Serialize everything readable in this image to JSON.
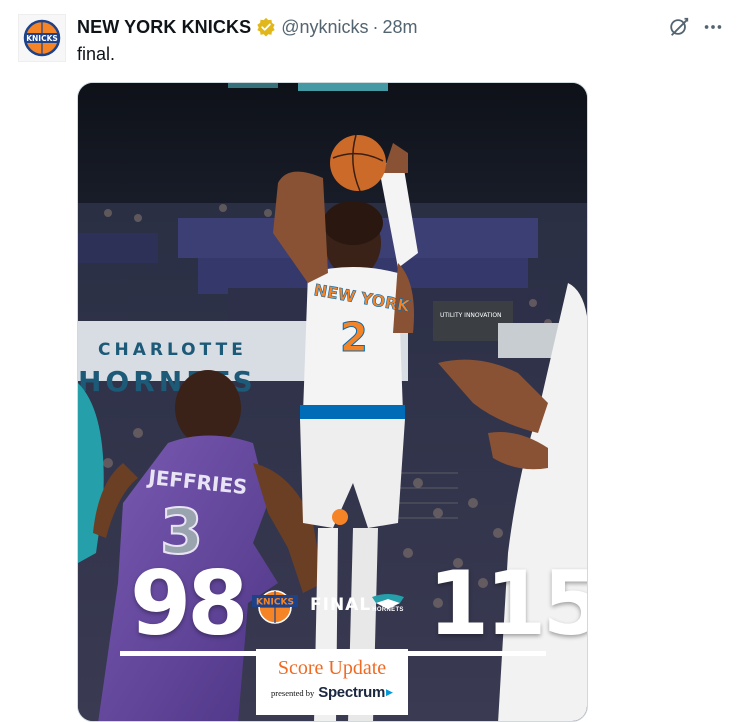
{
  "tweet": {
    "display_name": "NEW YORK KNICKS",
    "handle": "@nyknicks",
    "separator": "·",
    "time": "28m",
    "text": "final."
  },
  "icons": {
    "avatar": "knicks-logo-icon",
    "verified": "verified-badge-icon",
    "grok": "grok-icon",
    "more": "more-icon"
  },
  "media": {
    "arena_sign": "CHARLOTTE",
    "arena_sign_partial": "HORNETS",
    "utility_sign": "UTILITY INNOVATION",
    "player_jersey_city": "NEW YORK",
    "player_jersey_number": "2",
    "defender_name": "JEFFRIES",
    "defender_number": "3",
    "knicks_logo_text": "KNICKS",
    "hornets_logo_text": "HORNETS",
    "score_left": "98",
    "score_right": "115",
    "status": "FINAL",
    "banner_title": "Score Update",
    "banner_presented": "presented by",
    "banner_sponsor": "Spectrum"
  },
  "colors": {
    "knicks_orange": "#f58426",
    "knicks_blue": "#006bb6",
    "hornets_purple": "#6c4aa6",
    "hornets_teal": "#25a0aa",
    "verified_gold": "#e2b719",
    "spectrum_blue": "#0099dd"
  }
}
